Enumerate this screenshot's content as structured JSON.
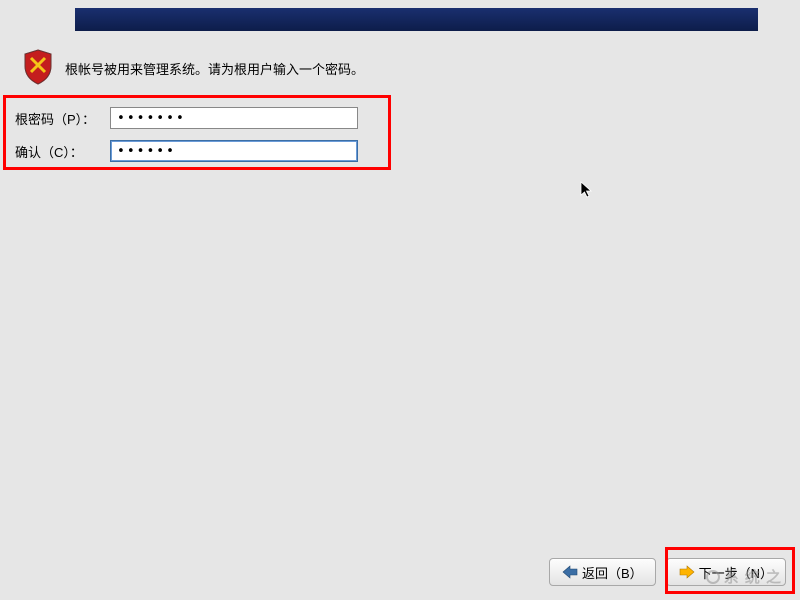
{
  "instruction": "根帐号被用来管理系统。请为根用户输入一个密码。",
  "fields": {
    "password_label": "根密码（P）：",
    "password_value": "•••••••",
    "confirm_label": "确认（C）：",
    "confirm_value": "••••••"
  },
  "buttons": {
    "back": "返回（B）",
    "next": "下一步（N）"
  },
  "watermark": "系  统  之"
}
